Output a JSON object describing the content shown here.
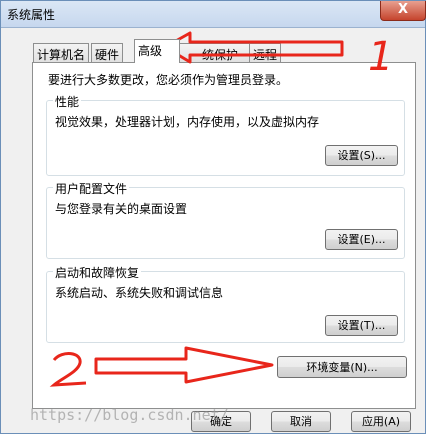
{
  "window": {
    "title": "系统属性",
    "close_label": "X"
  },
  "tabs": [
    {
      "label": "计算机名",
      "active": false
    },
    {
      "label": "硬件",
      "active": false
    },
    {
      "label": "高级",
      "active": true
    },
    {
      "label": "统保护",
      "active": false
    },
    {
      "label": "远程",
      "active": false
    }
  ],
  "panel": {
    "intro": "要进行大多数更改，您必须作为管理员登录。",
    "performance": {
      "title": "性能",
      "desc": "视觉效果，处理器计划，内存使用，以及虚拟内存",
      "button": "设置(S)..."
    },
    "profiles": {
      "title": "用户配置文件",
      "desc": "与您登录有关的桌面设置",
      "button": "设置(E)..."
    },
    "startup": {
      "title": "启动和故障恢复",
      "desc": "系统启动、系统失败和调试信息",
      "button": "设置(T)..."
    },
    "env_button": "环境变量(N)..."
  },
  "footer": {
    "ok": "确定",
    "cancel": "取消",
    "apply": "应用(A)"
  },
  "annotations": {
    "label1": "1",
    "label2": "2",
    "color": "#e8261b"
  },
  "watermark": "https://blog.csdn.net/"
}
